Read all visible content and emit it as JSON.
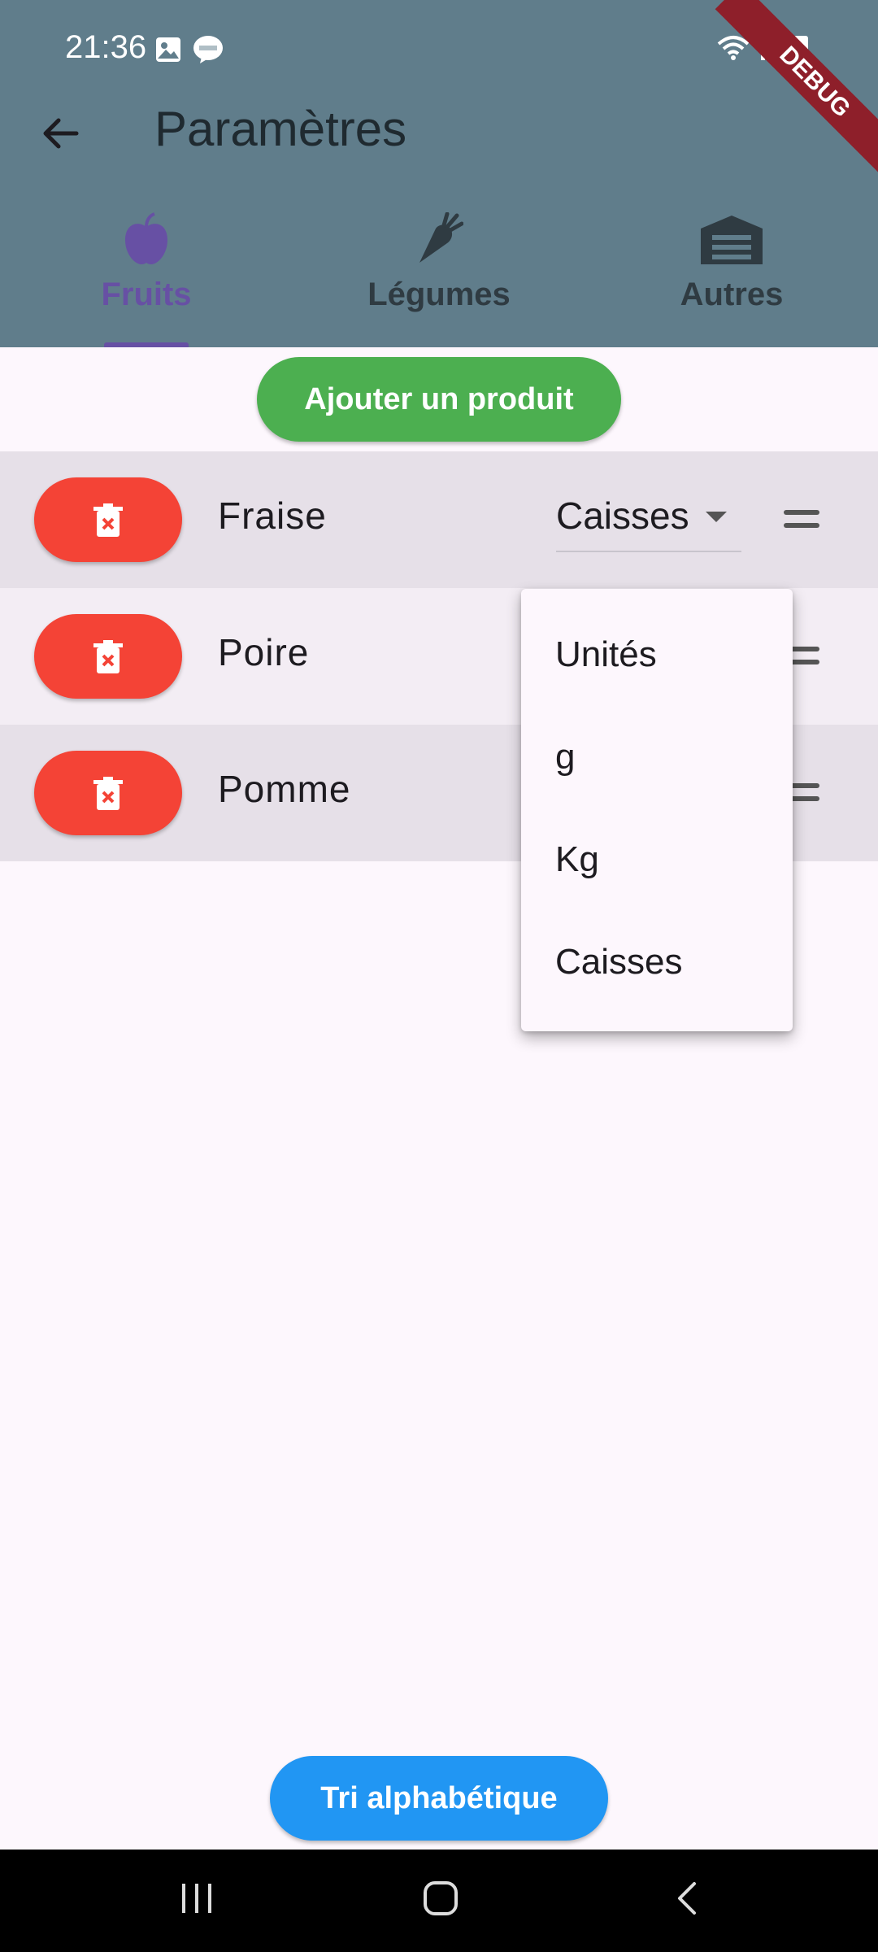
{
  "status_bar": {
    "time": "21:36"
  },
  "debug_banner": "DEBUG",
  "header": {
    "title": "Paramètres"
  },
  "tabs": [
    {
      "label": "Fruits",
      "icon": "apple-icon",
      "active": true
    },
    {
      "label": "Légumes",
      "icon": "carrot-icon",
      "active": false
    },
    {
      "label": "Autres",
      "icon": "storage-icon",
      "active": false
    }
  ],
  "add_button": "Ajouter un produit",
  "products": [
    {
      "name": "Fraise",
      "unit": "Caisses"
    },
    {
      "name": "Poire"
    },
    {
      "name": "Pomme"
    }
  ],
  "unit_dropdown": {
    "options": [
      "Unités",
      "g",
      "Kg",
      "Caisses"
    ]
  },
  "sort_button": "Tri alphabétique",
  "colors": {
    "app_bar": "#607D8B",
    "accent": "#6750A4",
    "add_button": "#4CAF50",
    "delete_button": "#F44336",
    "sort_button": "#2196F3"
  }
}
